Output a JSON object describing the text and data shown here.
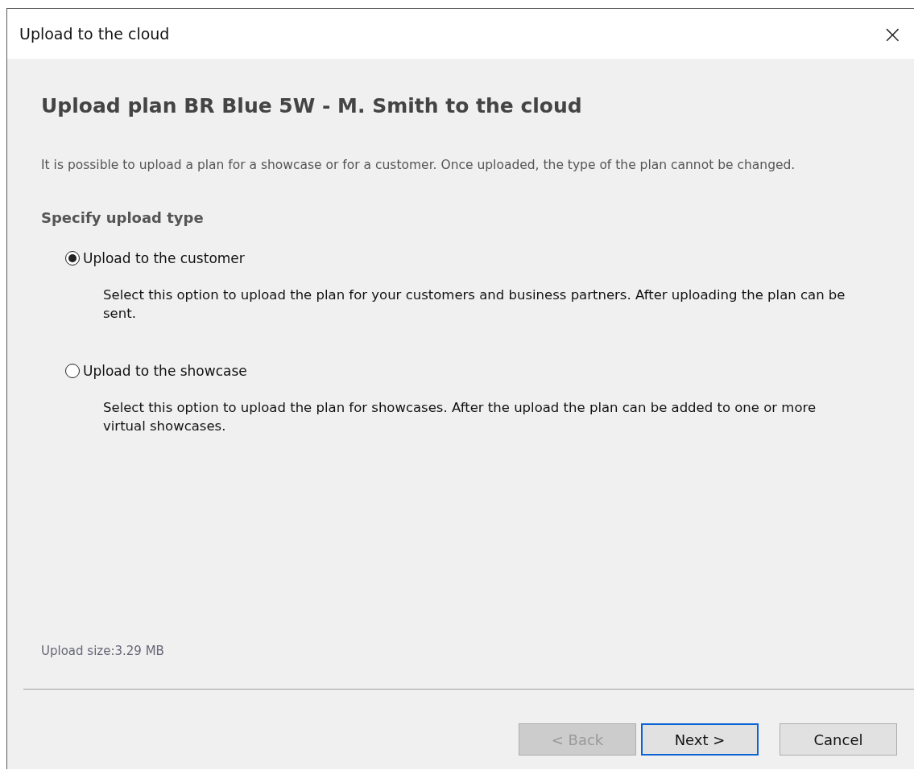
{
  "window": {
    "title": "Upload to the cloud",
    "close": "×"
  },
  "heading": "Upload plan BR Blue 5W - M. Smith to the cloud",
  "description": "It is possible to upload a plan for a showcase or for a customer. Once uploaded, the type of the plan cannot be changed.",
  "section_title": "Specify upload type",
  "options": [
    {
      "label": "Upload to the customer",
      "selected": true,
      "description": "Select this option to upload the plan for your customers and business partners. After uploading the plan can be sent."
    },
    {
      "label": "Upload to the showcase",
      "selected": false,
      "description": "Select this option to upload the plan for showcases. After the upload the plan can be added to one or more virtual showcases."
    }
  ],
  "upload_size": "Upload size:3.29 MB",
  "buttons": [
    {
      "label": "< Back",
      "disabled": true,
      "default": false
    },
    {
      "label": "Next >",
      "disabled": false,
      "default": true
    },
    {
      "label": "Cancel",
      "disabled": false,
      "default": false
    }
  ]
}
